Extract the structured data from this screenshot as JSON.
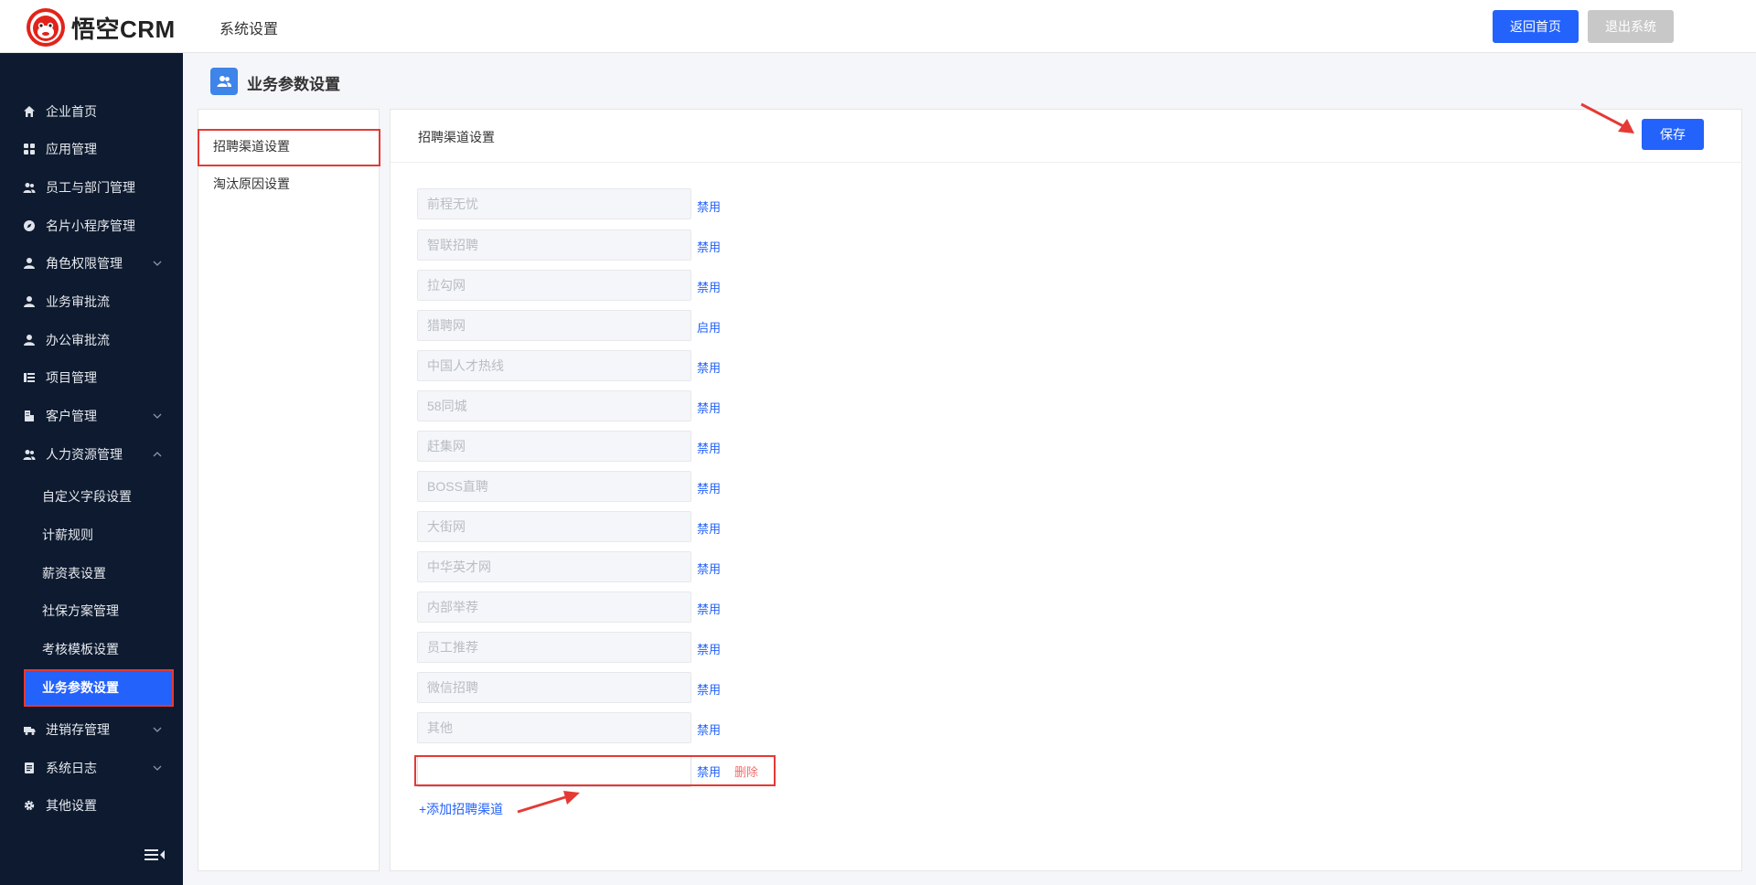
{
  "header": {
    "logo_text": "悟空CRM",
    "section_title": "系统设置",
    "home_button": "返回首页",
    "exit_button": "退出系统"
  },
  "sidebar": {
    "items": [
      {
        "label": "企业首页",
        "icon": "home-icon"
      },
      {
        "label": "应用管理",
        "icon": "grid-icon"
      },
      {
        "label": "员工与部门管理",
        "icon": "users-icon"
      },
      {
        "label": "名片小程序管理",
        "icon": "compass-icon"
      },
      {
        "label": "角色权限管理",
        "icon": "user-icon"
      },
      {
        "label": "业务审批流",
        "icon": "user-icon"
      },
      {
        "label": "办公审批流",
        "icon": "user-icon"
      },
      {
        "label": "项目管理",
        "icon": "list-icon"
      },
      {
        "label": "客户管理",
        "icon": "building-icon"
      },
      {
        "label": "人力资源管理",
        "icon": "users-icon"
      },
      {
        "label": "进销存管理",
        "icon": "truck-icon"
      },
      {
        "label": "系统日志",
        "icon": "doc-icon"
      },
      {
        "label": "其他设置",
        "icon": "gear-icon"
      }
    ],
    "hr_sub_items": [
      "自定义字段设置",
      "计薪规则",
      "薪资表设置",
      "社保方案管理",
      "考核模板设置",
      "业务参数设置"
    ]
  },
  "page": {
    "title": "业务参数设置"
  },
  "settings_menu": {
    "items": [
      "招聘渠道设置",
      "淘汰原因设置"
    ],
    "active": "招聘渠道设置"
  },
  "channel_panel": {
    "title": "招聘渠道设置",
    "save_button": "保存",
    "channels": [
      {
        "name": "前程无忧",
        "action": "禁用"
      },
      {
        "name": "智联招聘",
        "action": "禁用"
      },
      {
        "name": "拉勾网",
        "action": "禁用"
      },
      {
        "name": "猎聘网",
        "action": "启用"
      },
      {
        "name": "中国人才热线",
        "action": "禁用"
      },
      {
        "name": "58同城",
        "action": "禁用"
      },
      {
        "name": "赶集网",
        "action": "禁用"
      },
      {
        "name": "BOSS直聘",
        "action": "禁用"
      },
      {
        "name": "大街网",
        "action": "禁用"
      },
      {
        "name": "中华英才网",
        "action": "禁用"
      },
      {
        "name": "内部举荐",
        "action": "禁用"
      },
      {
        "name": "员工推荐",
        "action": "禁用"
      },
      {
        "name": "微信招聘",
        "action": "禁用"
      },
      {
        "name": "其他",
        "action": "禁用"
      }
    ],
    "new_row": {
      "value": "",
      "action": "禁用",
      "delete": "删除"
    },
    "add_link": "+添加招聘渠道"
  },
  "colors": {
    "primary": "#2362fb",
    "sidebar_bg": "#0d1a2f",
    "highlight": "#e53935",
    "delete": "#f56c6c"
  }
}
